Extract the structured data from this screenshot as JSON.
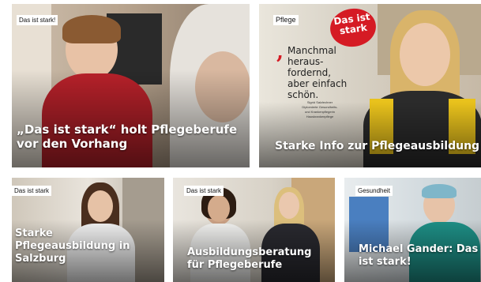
{
  "cards": [
    {
      "tag": "Das ist stark!",
      "title": "„Das ist stark“ holt Pflegeberufe\nvor den Vorhang"
    },
    {
      "tag": "Pflege",
      "title": "Starke Info zur Pflegeausbildung",
      "badge": "Das ist\nstark",
      "quote": "Manchmal\nheraus-\nfordernd,\naber einfach\nschön.",
      "quote_author": "Sigrid Salzlechner\nDiplomierte Gesundheits-\nund Krankenpflegerin\nHauskrankenpflege"
    },
    {
      "tag": "Das ist stark",
      "title": "Starke\nPflegeausbildung in\nSalzburg"
    },
    {
      "tag": "Das ist stark",
      "title": "Ausbildungsberatung\nfür Pflegeberufe"
    },
    {
      "tag": "Gesundheit",
      "title": "Michael Gander: Das\nist stark!"
    }
  ],
  "colors": {
    "brand_red": "#d51b24"
  }
}
